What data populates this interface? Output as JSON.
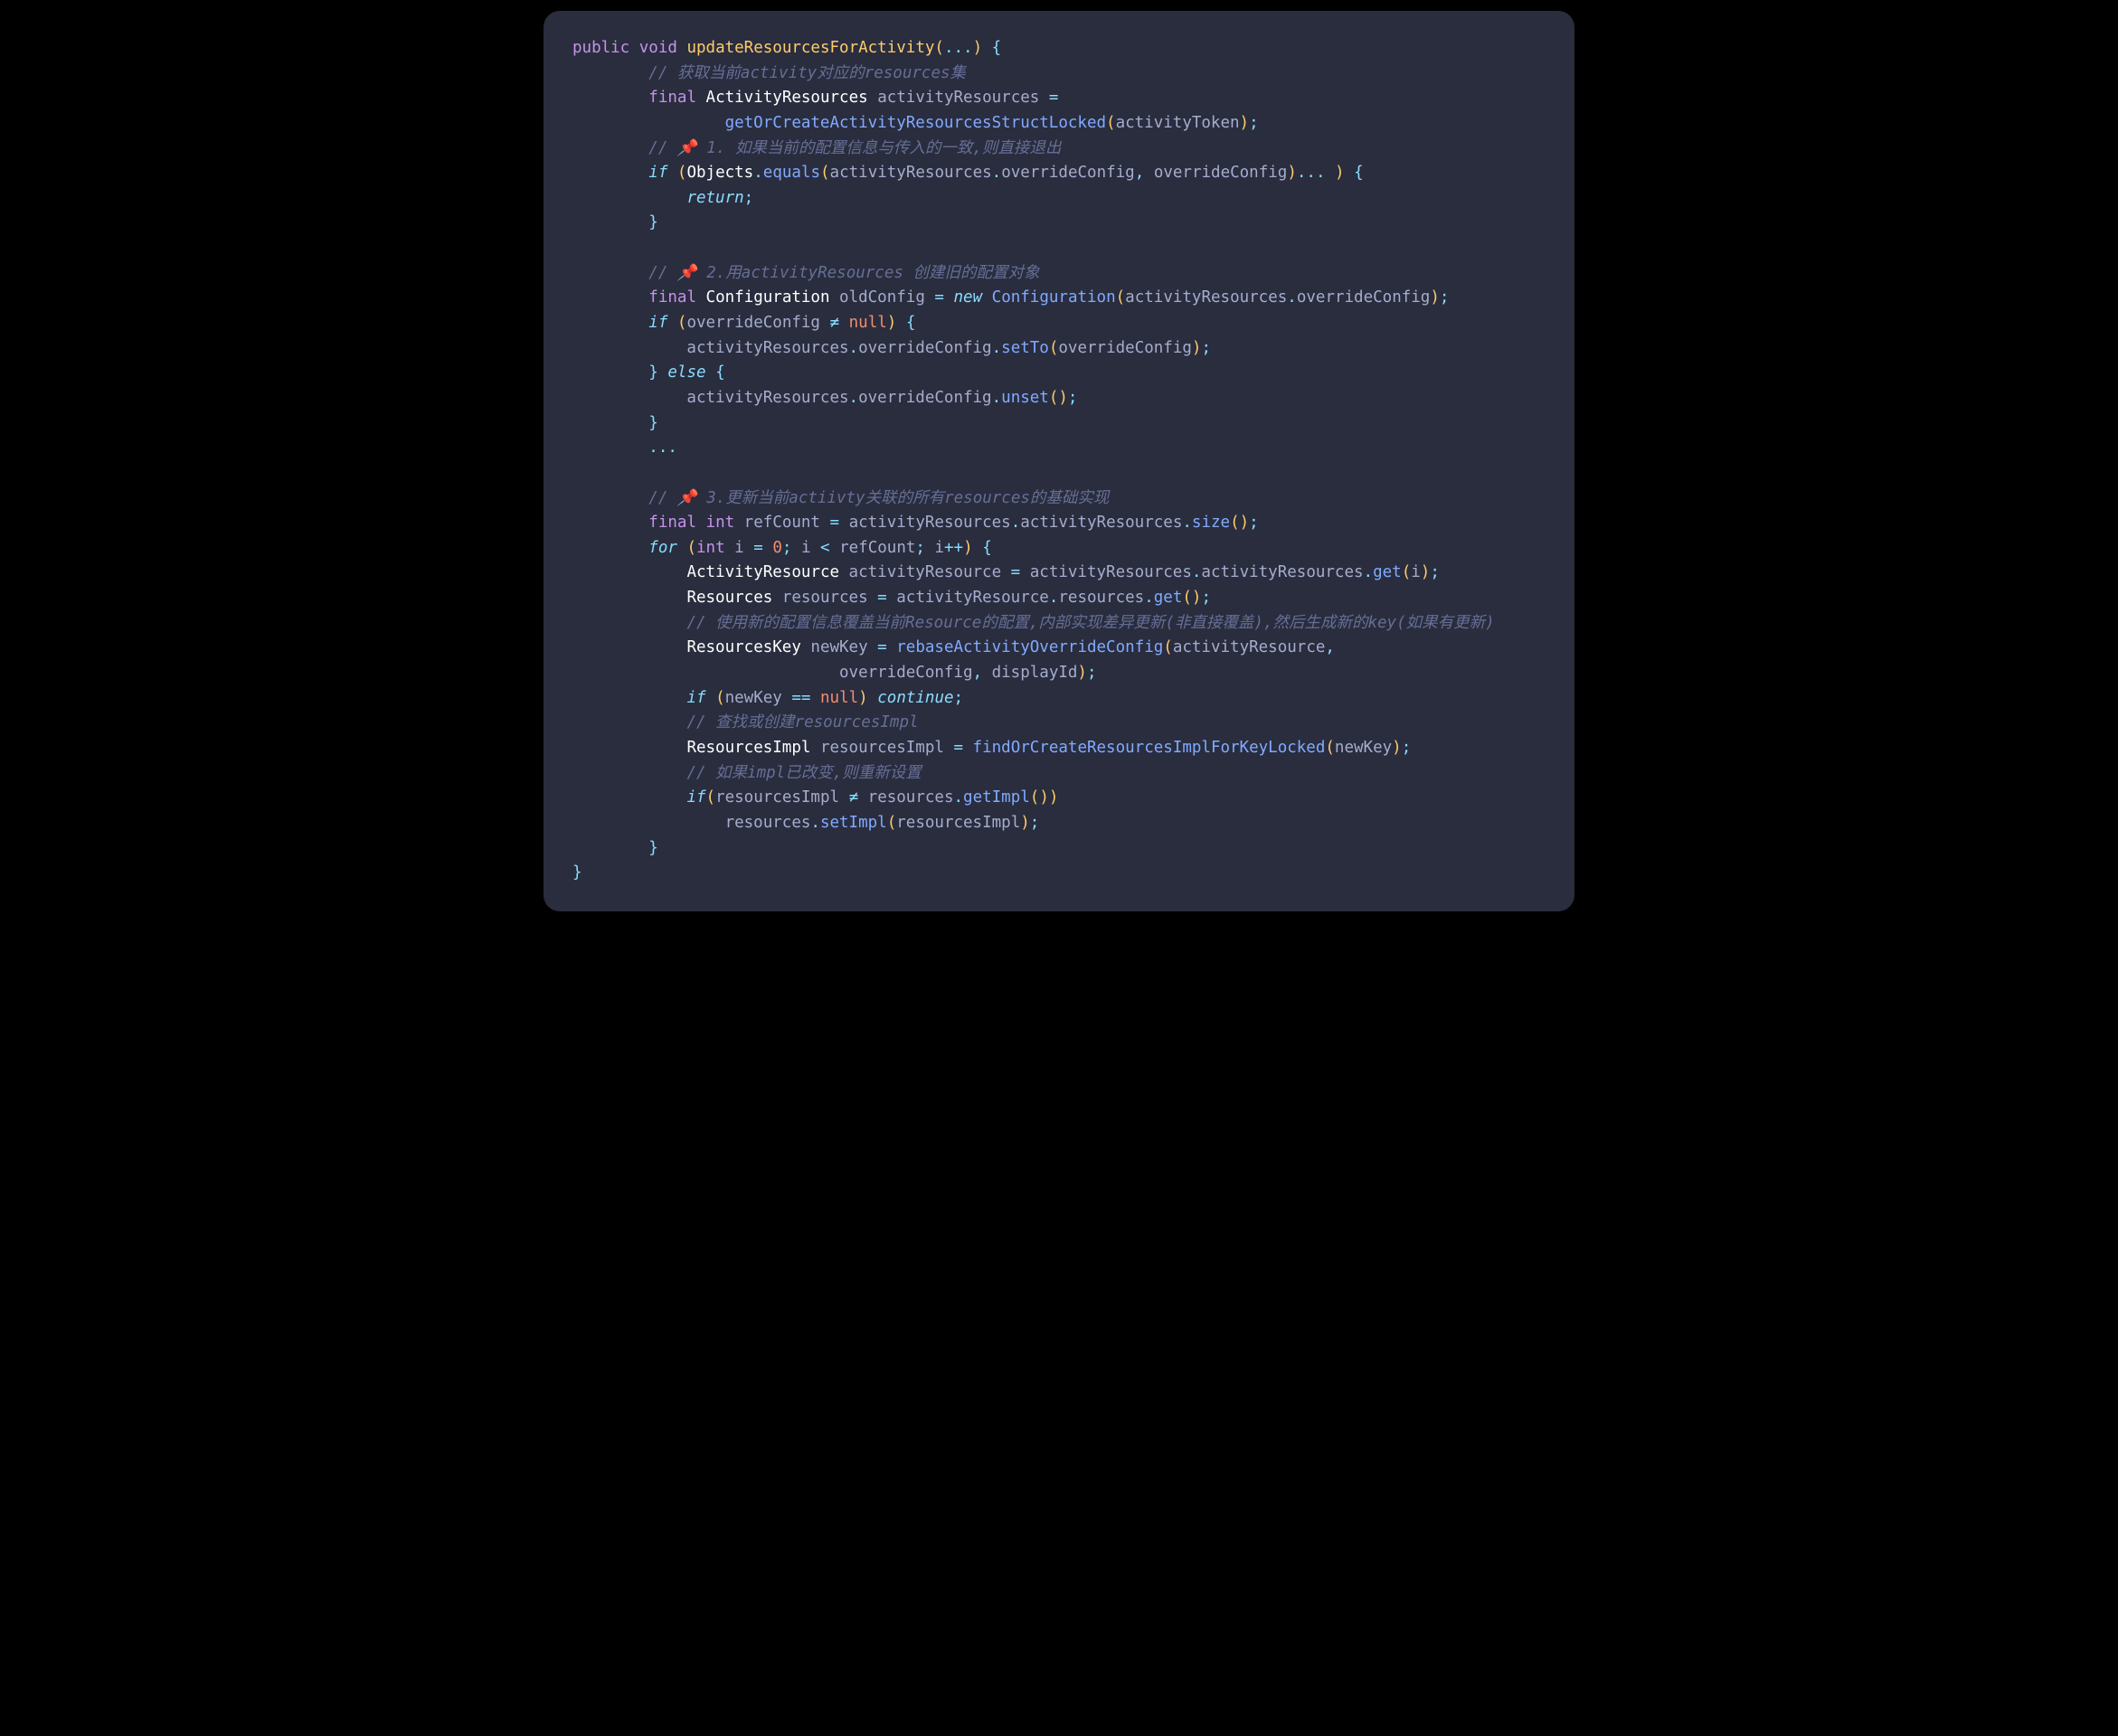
{
  "code": {
    "lines": [
      [
        {
          "c": "kw-public",
          "t": "public"
        },
        {
          "c": "plain",
          "t": " "
        },
        {
          "c": "kw-void",
          "t": "void"
        },
        {
          "c": "plain",
          "t": " "
        },
        {
          "c": "fn-name",
          "t": "updateResourcesForActivity"
        },
        {
          "c": "paren",
          "t": "("
        },
        {
          "c": "op",
          "t": "..."
        },
        {
          "c": "paren",
          "t": ")"
        },
        {
          "c": "plain",
          "t": " "
        },
        {
          "c": "brace",
          "t": "{"
        }
      ],
      [
        {
          "c": "plain",
          "t": "        "
        },
        {
          "c": "comment",
          "t": "// 获取当前activity对应的resources集"
        }
      ],
      [
        {
          "c": "plain",
          "t": "        "
        },
        {
          "c": "kw-final",
          "t": "final"
        },
        {
          "c": "plain",
          "t": " "
        },
        {
          "c": "type",
          "t": "ActivityResources"
        },
        {
          "c": "plain",
          "t": " activityResources "
        },
        {
          "c": "op",
          "t": "="
        }
      ],
      [
        {
          "c": "plain",
          "t": "                "
        },
        {
          "c": "fn-call",
          "t": "getOrCreateActivityResourcesStructLocked"
        },
        {
          "c": "paren",
          "t": "("
        },
        {
          "c": "ident",
          "t": "activityToken"
        },
        {
          "c": "paren",
          "t": ")"
        },
        {
          "c": "punct",
          "t": ";"
        }
      ],
      [
        {
          "c": "plain",
          "t": "        "
        },
        {
          "c": "comment",
          "t": "// 📌 1. 如果当前的配置信息与传入的一致,则直接退出"
        }
      ],
      [
        {
          "c": "plain",
          "t": "        "
        },
        {
          "c": "kw-if",
          "t": "if"
        },
        {
          "c": "plain",
          "t": " "
        },
        {
          "c": "paren",
          "t": "("
        },
        {
          "c": "type",
          "t": "Objects"
        },
        {
          "c": "punct",
          "t": "."
        },
        {
          "c": "fn-call",
          "t": "equals"
        },
        {
          "c": "paren",
          "t": "("
        },
        {
          "c": "ident",
          "t": "activityResources"
        },
        {
          "c": "punct",
          "t": "."
        },
        {
          "c": "ident",
          "t": "overrideConfig"
        },
        {
          "c": "punct",
          "t": ","
        },
        {
          "c": "plain",
          "t": " overrideConfig"
        },
        {
          "c": "paren",
          "t": ")"
        },
        {
          "c": "op",
          "t": "..."
        },
        {
          "c": "plain",
          "t": " "
        },
        {
          "c": "paren",
          "t": ")"
        },
        {
          "c": "plain",
          "t": " "
        },
        {
          "c": "brace",
          "t": "{"
        }
      ],
      [
        {
          "c": "plain",
          "t": "            "
        },
        {
          "c": "kw-return",
          "t": "return"
        },
        {
          "c": "punct",
          "t": ";"
        }
      ],
      [
        {
          "c": "plain",
          "t": "        "
        },
        {
          "c": "brace",
          "t": "}"
        }
      ],
      [
        {
          "c": "plain",
          "t": ""
        }
      ],
      [
        {
          "c": "plain",
          "t": "        "
        },
        {
          "c": "comment",
          "t": "// 📌 2.用activityResources 创建旧的配置对象"
        }
      ],
      [
        {
          "c": "plain",
          "t": "        "
        },
        {
          "c": "kw-final",
          "t": "final"
        },
        {
          "c": "plain",
          "t": " "
        },
        {
          "c": "type",
          "t": "Configuration"
        },
        {
          "c": "plain",
          "t": " oldConfig "
        },
        {
          "c": "op",
          "t": "="
        },
        {
          "c": "plain",
          "t": " "
        },
        {
          "c": "kw-new",
          "t": "new"
        },
        {
          "c": "plain",
          "t": " "
        },
        {
          "c": "fn-call",
          "t": "Configuration"
        },
        {
          "c": "paren",
          "t": "("
        },
        {
          "c": "ident",
          "t": "activityResources"
        },
        {
          "c": "punct",
          "t": "."
        },
        {
          "c": "ident",
          "t": "overrideConfig"
        },
        {
          "c": "paren",
          "t": ")"
        },
        {
          "c": "punct",
          "t": ";"
        }
      ],
      [
        {
          "c": "plain",
          "t": "        "
        },
        {
          "c": "kw-if",
          "t": "if"
        },
        {
          "c": "plain",
          "t": " "
        },
        {
          "c": "paren",
          "t": "("
        },
        {
          "c": "ident",
          "t": "overrideConfig"
        },
        {
          "c": "plain",
          "t": " "
        },
        {
          "c": "op",
          "t": "≠"
        },
        {
          "c": "plain",
          "t": " "
        },
        {
          "c": "kw-null",
          "t": "null"
        },
        {
          "c": "paren",
          "t": ")"
        },
        {
          "c": "plain",
          "t": " "
        },
        {
          "c": "brace",
          "t": "{"
        }
      ],
      [
        {
          "c": "plain",
          "t": "            activityResources"
        },
        {
          "c": "punct",
          "t": "."
        },
        {
          "c": "ident",
          "t": "overrideConfig"
        },
        {
          "c": "punct",
          "t": "."
        },
        {
          "c": "fn-call",
          "t": "setTo"
        },
        {
          "c": "paren",
          "t": "("
        },
        {
          "c": "ident",
          "t": "overrideConfig"
        },
        {
          "c": "paren",
          "t": ")"
        },
        {
          "c": "punct",
          "t": ";"
        }
      ],
      [
        {
          "c": "plain",
          "t": "        "
        },
        {
          "c": "brace",
          "t": "}"
        },
        {
          "c": "plain",
          "t": " "
        },
        {
          "c": "kw-else",
          "t": "else"
        },
        {
          "c": "plain",
          "t": " "
        },
        {
          "c": "brace",
          "t": "{"
        }
      ],
      [
        {
          "c": "plain",
          "t": "            activityResources"
        },
        {
          "c": "punct",
          "t": "."
        },
        {
          "c": "ident",
          "t": "overrideConfig"
        },
        {
          "c": "punct",
          "t": "."
        },
        {
          "c": "fn-call",
          "t": "unset"
        },
        {
          "c": "paren",
          "t": "()"
        },
        {
          "c": "punct",
          "t": ";"
        }
      ],
      [
        {
          "c": "plain",
          "t": "        "
        },
        {
          "c": "brace",
          "t": "}"
        }
      ],
      [
        {
          "c": "plain",
          "t": "        "
        },
        {
          "c": "op",
          "t": "..."
        }
      ],
      [
        {
          "c": "plain",
          "t": ""
        }
      ],
      [
        {
          "c": "plain",
          "t": "        "
        },
        {
          "c": "comment",
          "t": "// 📌 3.更新当前actiivty关联的所有resources的基础实现"
        }
      ],
      [
        {
          "c": "plain",
          "t": "        "
        },
        {
          "c": "kw-final",
          "t": "final"
        },
        {
          "c": "plain",
          "t": " "
        },
        {
          "c": "kw-int",
          "t": "int"
        },
        {
          "c": "plain",
          "t": " refCount "
        },
        {
          "c": "op",
          "t": "="
        },
        {
          "c": "plain",
          "t": " activityResources"
        },
        {
          "c": "punct",
          "t": "."
        },
        {
          "c": "ident",
          "t": "activityResources"
        },
        {
          "c": "punct",
          "t": "."
        },
        {
          "c": "fn-call",
          "t": "size"
        },
        {
          "c": "paren",
          "t": "()"
        },
        {
          "c": "punct",
          "t": ";"
        }
      ],
      [
        {
          "c": "plain",
          "t": "        "
        },
        {
          "c": "kw-for",
          "t": "for"
        },
        {
          "c": "plain",
          "t": " "
        },
        {
          "c": "paren",
          "t": "("
        },
        {
          "c": "kw-int",
          "t": "int"
        },
        {
          "c": "plain",
          "t": " i "
        },
        {
          "c": "op",
          "t": "="
        },
        {
          "c": "plain",
          "t": " "
        },
        {
          "c": "num",
          "t": "0"
        },
        {
          "c": "punct",
          "t": ";"
        },
        {
          "c": "plain",
          "t": " i "
        },
        {
          "c": "op",
          "t": "<"
        },
        {
          "c": "plain",
          "t": " refCount"
        },
        {
          "c": "punct",
          "t": ";"
        },
        {
          "c": "plain",
          "t": " i"
        },
        {
          "c": "op",
          "t": "++"
        },
        {
          "c": "paren",
          "t": ")"
        },
        {
          "c": "plain",
          "t": " "
        },
        {
          "c": "brace",
          "t": "{"
        }
      ],
      [
        {
          "c": "plain",
          "t": "            "
        },
        {
          "c": "type",
          "t": "ActivityResource"
        },
        {
          "c": "plain",
          "t": " activityResource "
        },
        {
          "c": "op",
          "t": "="
        },
        {
          "c": "plain",
          "t": " activityResources"
        },
        {
          "c": "punct",
          "t": "."
        },
        {
          "c": "ident",
          "t": "activityResources"
        },
        {
          "c": "punct",
          "t": "."
        },
        {
          "c": "fn-call",
          "t": "get"
        },
        {
          "c": "paren",
          "t": "("
        },
        {
          "c": "ident",
          "t": "i"
        },
        {
          "c": "paren",
          "t": ")"
        },
        {
          "c": "punct",
          "t": ";"
        }
      ],
      [
        {
          "c": "plain",
          "t": "            "
        },
        {
          "c": "type",
          "t": "Resources"
        },
        {
          "c": "plain",
          "t": " resources "
        },
        {
          "c": "op",
          "t": "="
        },
        {
          "c": "plain",
          "t": " activityResource"
        },
        {
          "c": "punct",
          "t": "."
        },
        {
          "c": "ident",
          "t": "resources"
        },
        {
          "c": "punct",
          "t": "."
        },
        {
          "c": "fn-call",
          "t": "get"
        },
        {
          "c": "paren",
          "t": "()"
        },
        {
          "c": "punct",
          "t": ";"
        }
      ],
      [
        {
          "c": "plain",
          "t": "            "
        },
        {
          "c": "comment",
          "t": "// 使用新的配置信息覆盖当前Resource的配置,内部实现差异更新(非直接覆盖),然后生成新的key(如果有更新)"
        }
      ],
      [
        {
          "c": "plain",
          "t": "            "
        },
        {
          "c": "type",
          "t": "ResourcesKey"
        },
        {
          "c": "plain",
          "t": " newKey "
        },
        {
          "c": "op",
          "t": "="
        },
        {
          "c": "plain",
          "t": " "
        },
        {
          "c": "fn-call",
          "t": "rebaseActivityOverrideConfig"
        },
        {
          "c": "paren",
          "t": "("
        },
        {
          "c": "ident",
          "t": "activityResource"
        },
        {
          "c": "punct",
          "t": ","
        }
      ],
      [
        {
          "c": "plain",
          "t": "                            overrideConfig"
        },
        {
          "c": "punct",
          "t": ","
        },
        {
          "c": "plain",
          "t": " displayId"
        },
        {
          "c": "paren",
          "t": ")"
        },
        {
          "c": "punct",
          "t": ";"
        }
      ],
      [
        {
          "c": "plain",
          "t": "            "
        },
        {
          "c": "kw-if",
          "t": "if"
        },
        {
          "c": "plain",
          "t": " "
        },
        {
          "c": "paren",
          "t": "("
        },
        {
          "c": "ident",
          "t": "newKey"
        },
        {
          "c": "plain",
          "t": " "
        },
        {
          "c": "op",
          "t": "=="
        },
        {
          "c": "plain",
          "t": " "
        },
        {
          "c": "kw-null",
          "t": "null"
        },
        {
          "c": "paren",
          "t": ")"
        },
        {
          "c": "plain",
          "t": " "
        },
        {
          "c": "kw-continue",
          "t": "continue"
        },
        {
          "c": "punct",
          "t": ";"
        }
      ],
      [
        {
          "c": "plain",
          "t": "            "
        },
        {
          "c": "comment",
          "t": "// 查找或创建resourcesImpl"
        }
      ],
      [
        {
          "c": "plain",
          "t": "            "
        },
        {
          "c": "type",
          "t": "ResourcesImpl"
        },
        {
          "c": "plain",
          "t": " resourcesImpl "
        },
        {
          "c": "op",
          "t": "="
        },
        {
          "c": "plain",
          "t": " "
        },
        {
          "c": "fn-call",
          "t": "findOrCreateResourcesImplForKeyLocked"
        },
        {
          "c": "paren",
          "t": "("
        },
        {
          "c": "ident",
          "t": "newKey"
        },
        {
          "c": "paren",
          "t": ")"
        },
        {
          "c": "punct",
          "t": ";"
        }
      ],
      [
        {
          "c": "plain",
          "t": "            "
        },
        {
          "c": "comment",
          "t": "// 如果impl已改变,则重新设置"
        }
      ],
      [
        {
          "c": "plain",
          "t": "            "
        },
        {
          "c": "kw-if",
          "t": "if"
        },
        {
          "c": "paren",
          "t": "("
        },
        {
          "c": "ident",
          "t": "resourcesImpl"
        },
        {
          "c": "plain",
          "t": " "
        },
        {
          "c": "op",
          "t": "≠"
        },
        {
          "c": "plain",
          "t": " resources"
        },
        {
          "c": "punct",
          "t": "."
        },
        {
          "c": "fn-call",
          "t": "getImpl"
        },
        {
          "c": "paren",
          "t": "()"
        },
        {
          "c": "paren",
          "t": ")"
        }
      ],
      [
        {
          "c": "plain",
          "t": "                resources"
        },
        {
          "c": "punct",
          "t": "."
        },
        {
          "c": "fn-call",
          "t": "setImpl"
        },
        {
          "c": "paren",
          "t": "("
        },
        {
          "c": "ident",
          "t": "resourcesImpl"
        },
        {
          "c": "paren",
          "t": ")"
        },
        {
          "c": "punct",
          "t": ";"
        }
      ],
      [
        {
          "c": "plain",
          "t": "        "
        },
        {
          "c": "brace",
          "t": "}"
        }
      ],
      [
        {
          "c": "brace",
          "t": "}"
        }
      ]
    ]
  }
}
